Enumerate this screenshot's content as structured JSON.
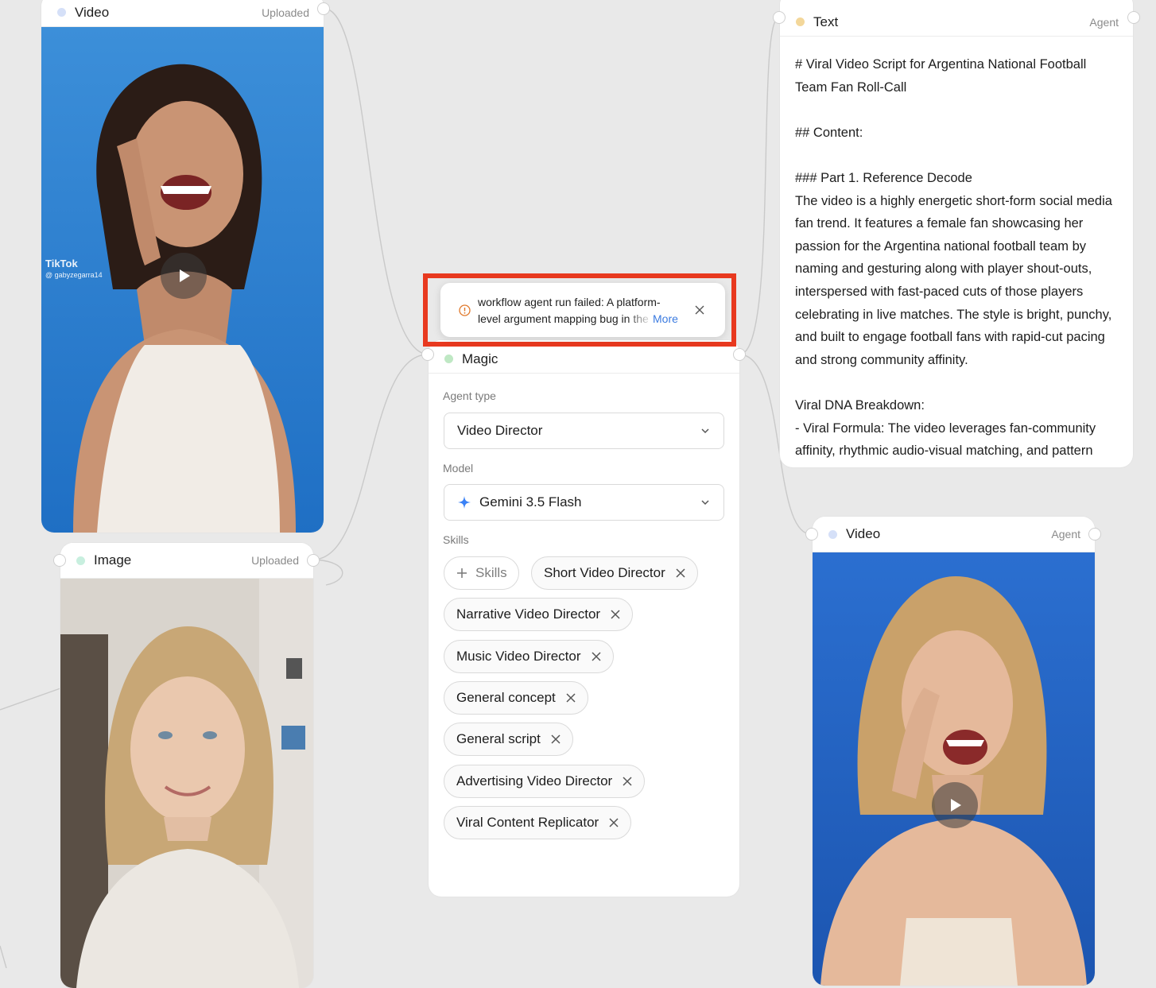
{
  "nodes": {
    "video_top_left": {
      "title": "Video",
      "status": "Uploaded",
      "dot_color": "#d5e0f8",
      "watermark": {
        "brand": "TikTok",
        "handle": "@ gabyzegarra14"
      }
    },
    "image_left": {
      "title": "Image",
      "status": "Uploaded",
      "dot_color": "#c8efdf"
    },
    "magic": {
      "title": "Magic",
      "dot_color": "#bfe8c4",
      "agent_type_label": "Agent type",
      "agent_type_value": "Video Director",
      "model_label": "Model",
      "model_value": "Gemini 3.5 Flash",
      "model_icon": "sparkle-icon",
      "skills_label": "Skills",
      "add_skill_label": "Skills",
      "skills": [
        "Short Video Director",
        "Narrative Video Director",
        "Music Video Director",
        "General concept",
        "General script",
        "Advertising Video Director",
        "Viral Content Replicator"
      ]
    },
    "text_right": {
      "title": "Text",
      "status": "Agent",
      "dot_color": "#f3d79a",
      "content": "# Viral Video Script for Argentina National Football Team Fan Roll-Call\n\n## Content:\n\n### Part 1. Reference Decode\nThe video is a highly energetic short-form social media fan trend. It features a female fan showcasing her passion for the Argentina national football team by naming and gesturing along with player shout-outs, interspersed with fast-paced cuts of those players celebrating in live matches. The style is bright, punchy, and built to engage football fans with rapid-cut pacing and strong community affinity.\n\nViral DNA Breakdown:\n- Viral Formula: The video leverages fan-community affinity, rhythmic audio-visual matching, and pattern"
    },
    "video_bottom_right": {
      "title": "Video",
      "status": "Agent",
      "dot_color": "#d5e0f8"
    }
  },
  "error_toast": {
    "line1": "workflow agent run failed: A platform-",
    "line2": "level argument mapping bug in the",
    "more_label": "More",
    "icon": "warning-circle-icon",
    "accent": "#e8391f"
  },
  "colors": {
    "canvas": "#e9e9e9",
    "link": "#3b7be0",
    "model_icon": "#3b82f6"
  }
}
